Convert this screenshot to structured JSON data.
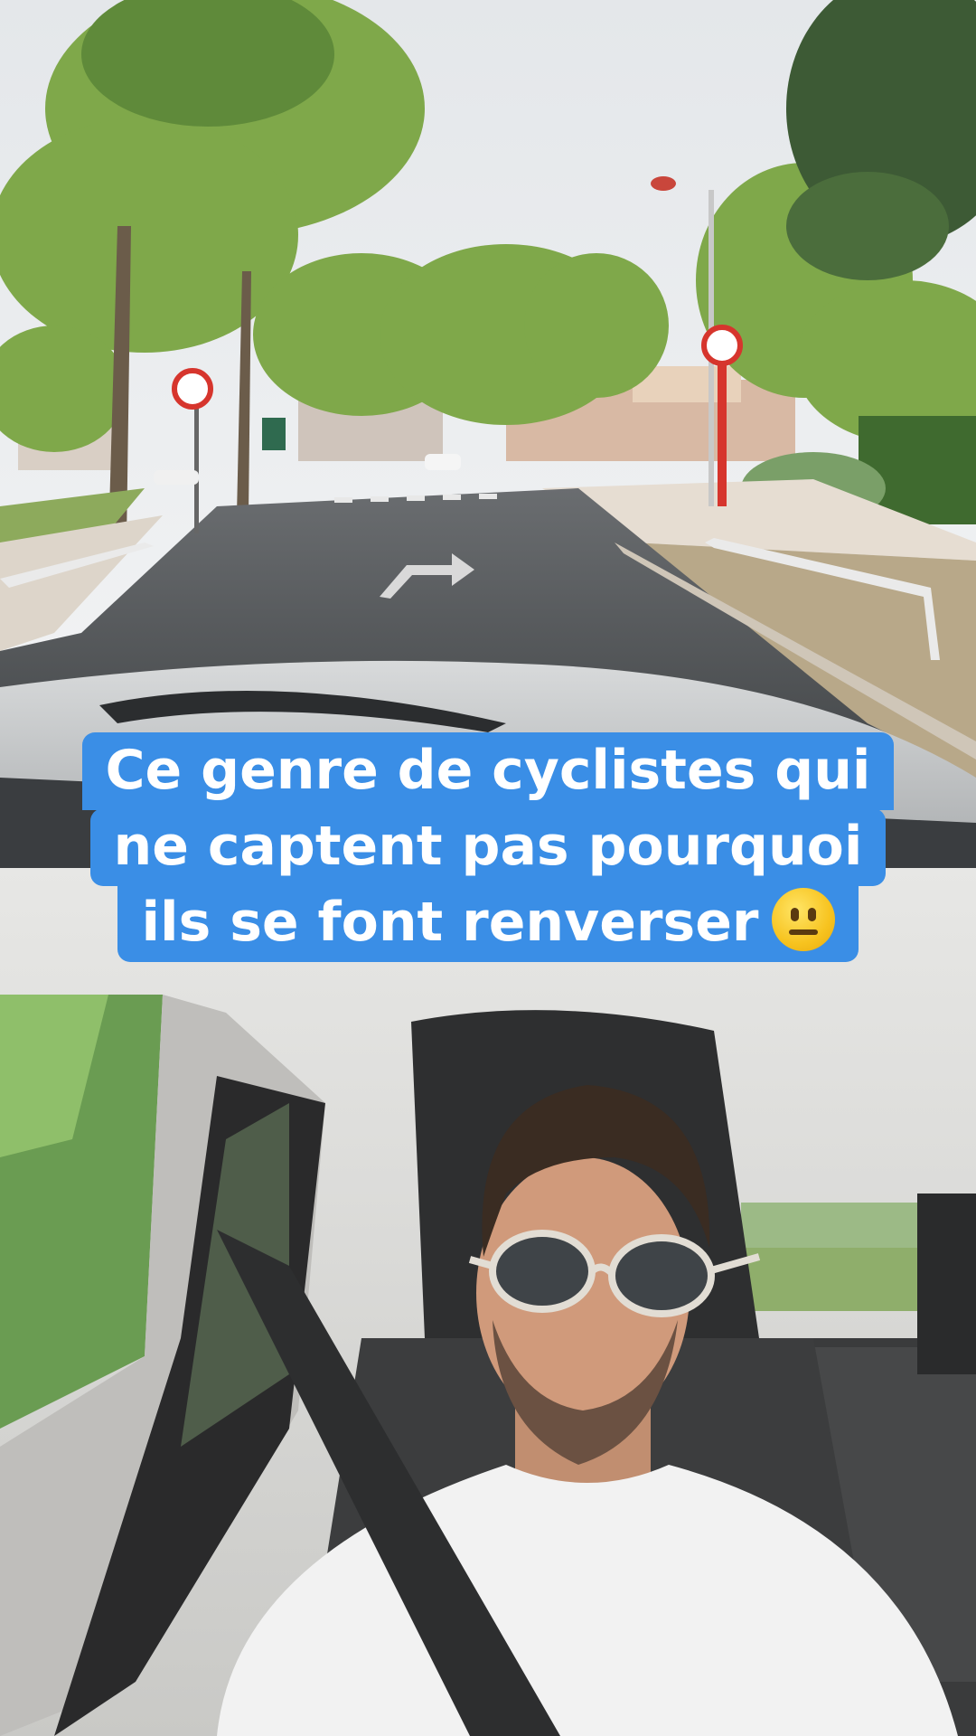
{
  "caption": {
    "lines": [
      "Ce genre de cyclistes qui",
      "ne captent pas pourquoi",
      "ils se font renverser"
    ],
    "emoji": "neutral-face-emoji",
    "background_color": "#3a8ee6",
    "text_color": "#ffffff"
  }
}
